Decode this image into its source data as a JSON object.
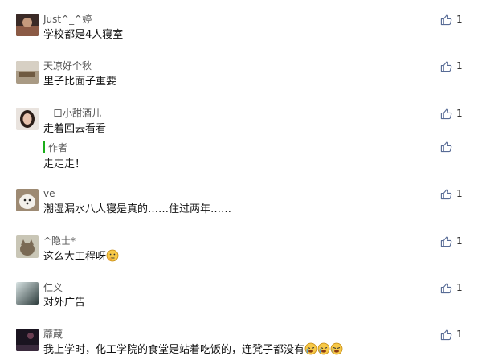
{
  "colors": {
    "accent": "#1aad19",
    "icon": "#576b95"
  },
  "comments": [
    {
      "author": "Just^_^婷",
      "text": "学校都是4人寝室",
      "likes": "1",
      "avatar_icon": "avatar-dark"
    },
    {
      "author": "天凉好个秋",
      "text": "里子比面子重要",
      "likes": "1",
      "avatar_icon": "avatar-landscape"
    },
    {
      "author": "一口小甜酒儿",
      "text": "走着回去看看",
      "likes": "1",
      "avatar_icon": "avatar-girl",
      "reply": {
        "label": "作者",
        "text": "走走走！"
      }
    },
    {
      "author": "ve",
      "text": "潮湿漏水八人寝是真的……住过两年……",
      "likes": "1",
      "avatar_icon": "avatar-dog"
    },
    {
      "author": "^隐士*",
      "text": "这么大工程呀",
      "likes": "1",
      "avatar_icon": "avatar-cat",
      "emoji": "thinking-face"
    },
    {
      "author": "仁义",
      "text": "对外广告",
      "likes": "1",
      "avatar_icon": "avatar-gradient"
    },
    {
      "author": "蘼蔵",
      "text": "我上学时，化工学院的食堂是站着吃饭的，连凳子都没有",
      "likes": "1",
      "avatar_icon": "avatar-night",
      "emoji": "crying-face-x3"
    }
  ]
}
